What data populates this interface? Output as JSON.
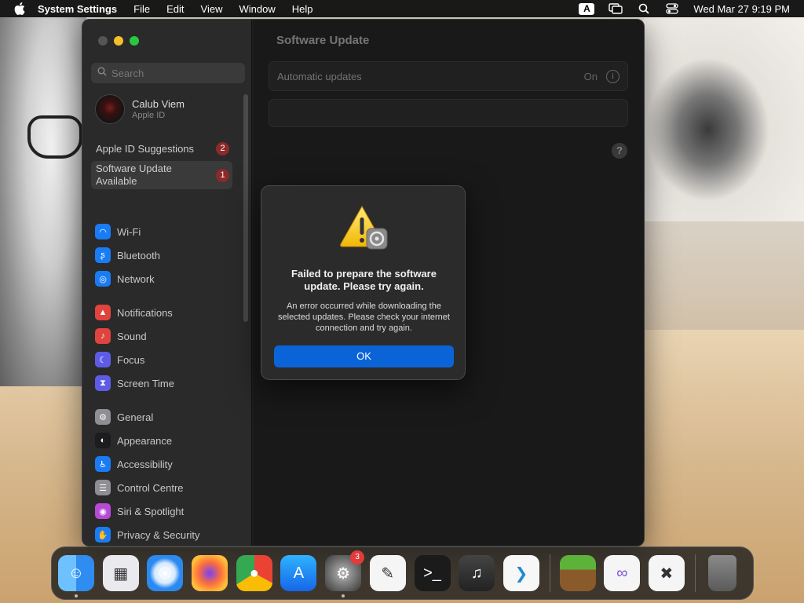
{
  "menubar": {
    "app_name": "System Settings",
    "menus": [
      "File",
      "Edit",
      "View",
      "Window",
      "Help"
    ],
    "input_badge": "A",
    "datetime": "Wed Mar 27  9:19 PM"
  },
  "sidebar": {
    "search_placeholder": "Search",
    "account": {
      "name": "Calub Viem",
      "subtitle": "Apple ID"
    },
    "suggestions": {
      "label": "Apple ID Suggestions",
      "count": "2"
    },
    "update_available": {
      "label_line1": "Software Update",
      "label_line2": "Available",
      "count": "1"
    },
    "items": [
      {
        "label": "Wi-Fi",
        "icon": "wifi-icon",
        "color": "#1a7cf5"
      },
      {
        "label": "Bluetooth",
        "icon": "bluetooth-icon",
        "color": "#1a7cf5"
      },
      {
        "label": "Network",
        "icon": "network-icon",
        "color": "#1a7cf5"
      },
      {
        "label": "Notifications",
        "icon": "notifications-icon",
        "color": "#e0443e"
      },
      {
        "label": "Sound",
        "icon": "sound-icon",
        "color": "#e0443e"
      },
      {
        "label": "Focus",
        "icon": "focus-icon",
        "color": "#5e5ce6"
      },
      {
        "label": "Screen Time",
        "icon": "screen-time-icon",
        "color": "#5e5ce6"
      },
      {
        "label": "General",
        "icon": "general-icon",
        "color": "#8e8e93"
      },
      {
        "label": "Appearance",
        "icon": "appearance-icon",
        "color": "#1c1c1e"
      },
      {
        "label": "Accessibility",
        "icon": "accessibility-icon",
        "color": "#1a7cf5"
      },
      {
        "label": "Control Centre",
        "icon": "control-centre-icon",
        "color": "#8e8e93"
      },
      {
        "label": "Siri & Spotlight",
        "icon": "siri-icon",
        "color": "#b84ad8"
      },
      {
        "label": "Privacy & Security",
        "icon": "privacy-icon",
        "color": "#1a7cf5"
      }
    ]
  },
  "content": {
    "title": "Software Update",
    "automatic_updates_label": "Automatic updates",
    "automatic_updates_value": "On",
    "info_glyph": "i",
    "help_glyph": "?"
  },
  "alert": {
    "title": "Failed to prepare the software update. Please try again.",
    "message": "An error occurred while downloading the selected updates. Please check your internet connection and try again.",
    "ok_label": "OK"
  },
  "dock": {
    "apps": [
      {
        "name": "Finder",
        "icon": "finder-icon",
        "running": true
      },
      {
        "name": "Launchpad",
        "icon": "launchpad-icon",
        "running": false
      },
      {
        "name": "Safari",
        "icon": "safari-icon",
        "running": false
      },
      {
        "name": "Firefox",
        "icon": "firefox-icon",
        "running": false
      },
      {
        "name": "Chrome",
        "icon": "chrome-icon",
        "running": false
      },
      {
        "name": "App Store",
        "icon": "app-store-icon",
        "running": false
      },
      {
        "name": "System Settings",
        "icon": "system-settings-icon",
        "running": true,
        "badge": "3"
      },
      {
        "name": "TextEdit",
        "icon": "textedit-icon",
        "running": false
      },
      {
        "name": "Terminal",
        "icon": "terminal-icon",
        "running": false
      },
      {
        "name": "GarageBand",
        "icon": "garageband-icon",
        "running": false
      },
      {
        "name": "VS Code",
        "icon": "vscode-icon",
        "running": false
      },
      {
        "name": "Minecraft",
        "icon": "minecraft-icon",
        "running": false
      },
      {
        "name": "Visual Studio",
        "icon": "visual-studio-icon",
        "running": false
      },
      {
        "name": "CapCut",
        "icon": "capcut-icon",
        "running": false
      },
      {
        "name": "Trash",
        "icon": "trash-icon",
        "running": false
      }
    ]
  }
}
